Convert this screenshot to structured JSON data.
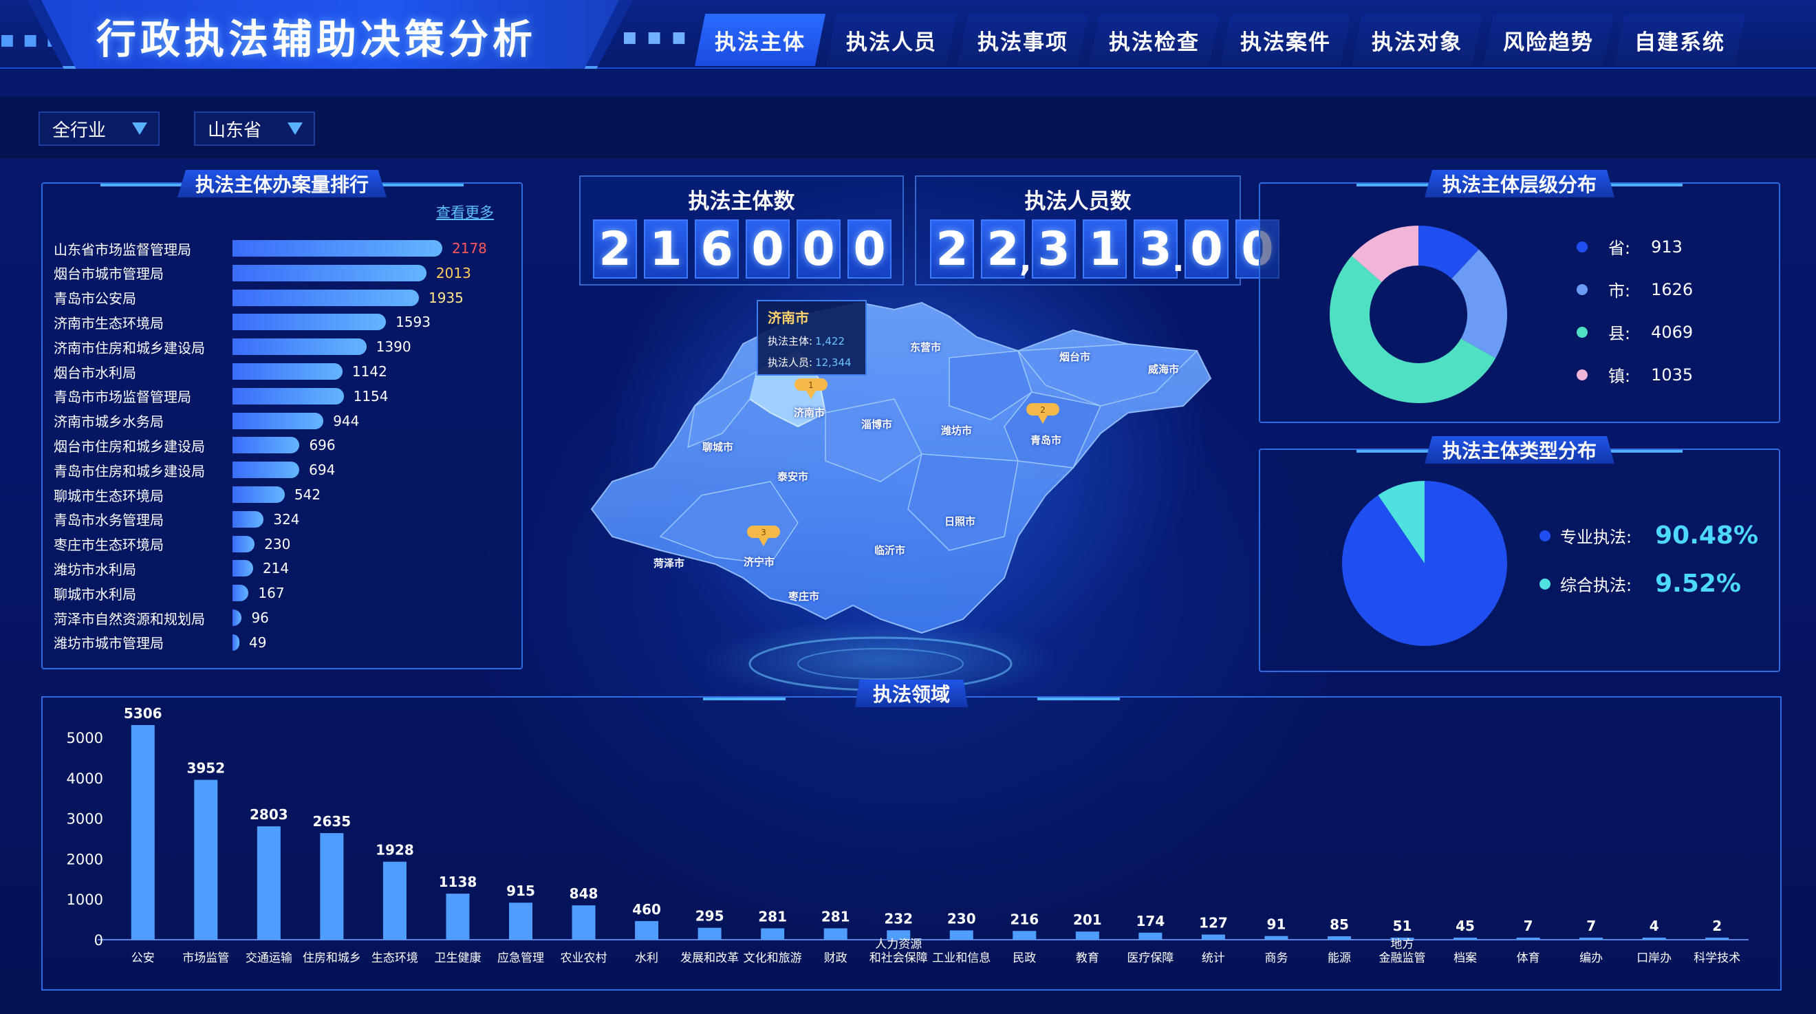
{
  "header": {
    "title": "行政执法辅助决策分析",
    "dots": "■ ■ ■",
    "tabs": [
      "执法主体",
      "执法人员",
      "执法事项",
      "执法检查",
      "执法案件",
      "执法对象",
      "风险趋势",
      "自建系统"
    ],
    "active_tab": 0
  },
  "filters": {
    "industry": "全行业",
    "province": "山东省"
  },
  "ranking": {
    "title": "执法主体办案量排行",
    "more_label": "查看更多",
    "items": [
      {
        "name": "山东省市场监督管理局",
        "value": 2178,
        "color": "#ff5a5a"
      },
      {
        "name": "烟台市城市管理局",
        "value": 2013,
        "color": "#ffcf5a"
      },
      {
        "name": "青岛市公安局",
        "value": 1935,
        "color": "#ffe88a"
      },
      {
        "name": "济南市生态环境局",
        "value": 1593,
        "color": "#ffffff"
      },
      {
        "name": "济南市住房和城乡建设局",
        "value": 1390,
        "color": "#ffffff"
      },
      {
        "name": "烟台市水利局",
        "value": 1142,
        "color": "#ffffff"
      },
      {
        "name": "青岛市市场监督管理局",
        "value": 1154,
        "color": "#ffffff"
      },
      {
        "name": "济南市城乡水务局",
        "value": 944,
        "color": "#ffffff"
      },
      {
        "name": "烟台市住房和城乡建设局",
        "value": 696,
        "color": "#ffffff"
      },
      {
        "name": "青岛市住房和城乡建设局",
        "value": 694,
        "color": "#ffffff"
      },
      {
        "name": "聊城市生态环境局",
        "value": 542,
        "color": "#ffffff"
      },
      {
        "name": "青岛市水务管理局",
        "value": 324,
        "color": "#ffffff"
      },
      {
        "name": "枣庄市生态环境局",
        "value": 230,
        "color": "#ffffff"
      },
      {
        "name": "潍坊市水利局",
        "value": 214,
        "color": "#ffffff"
      },
      {
        "name": "聊城市水利局",
        "value": 167,
        "color": "#ffffff"
      },
      {
        "name": "菏泽市自然资源和规划局",
        "value": 96,
        "color": "#ffffff"
      },
      {
        "name": "潍坊市城市管理局",
        "value": 49,
        "color": "#ffffff"
      }
    ]
  },
  "kpi": {
    "subjects_label": "执法主体数",
    "subjects_digits": [
      "2",
      "1",
      "6",
      "0",
      "0",
      "0"
    ],
    "staff_label": "执法人员数",
    "staff_digits": [
      "2",
      "2",
      ",",
      "3",
      "1",
      "3",
      ".",
      "0",
      "0"
    ]
  },
  "map": {
    "tooltip": {
      "city": "济南市",
      "subjects_label": "执法主体:",
      "subjects_value": "1,422",
      "staff_label": "执法人员:",
      "staff_value": "12,344"
    },
    "cities": [
      "济南市",
      "东营市",
      "烟台市",
      "威海市",
      "淄博市",
      "潍坊市",
      "青岛市",
      "聊城市",
      "泰安市",
      "日照市",
      "济宁市",
      "临沂市",
      "菏泽市",
      "枣庄市"
    ],
    "markers": [
      "1",
      "2",
      "3"
    ]
  },
  "level_dist": {
    "title": "执法主体层级分布",
    "items": [
      {
        "label": "省:",
        "value": 913,
        "color": "#1f4ff0"
      },
      {
        "label": "市:",
        "value": 1626,
        "color": "#6a9cf5"
      },
      {
        "label": "县:",
        "value": 4069,
        "color": "#4fe0c3"
      },
      {
        "label": "镇:",
        "value": 1035,
        "color": "#f2b5da"
      }
    ]
  },
  "type_dist": {
    "title": "执法主体类型分布",
    "items": [
      {
        "label": "专业执法:",
        "value": "90.48%",
        "fraction": 0.9048,
        "color": "#1f4ff0"
      },
      {
        "label": "综合执法:",
        "value": "9.52%",
        "fraction": 0.0952,
        "color": "#4fe0e0"
      }
    ]
  },
  "chart_data": {
    "type": "bar",
    "title": "执法领域",
    "xlabel": "",
    "ylabel": "",
    "ylim": [
      0,
      5000
    ],
    "yticks": [
      0,
      1000,
      2000,
      3000,
      4000,
      5000
    ],
    "categories": [
      "公安",
      "市场监管",
      "交通运输",
      "住房和城乡",
      "生态环境",
      "卫生健康",
      "应急管理",
      "农业农村",
      "水利",
      "发展和改革",
      "文化和旅游",
      "财政",
      "人力资源\n和社会保障",
      "工业和信息",
      "民政",
      "教育",
      "医疗保障",
      "统计",
      "商务",
      "能源",
      "地方\n金融监管",
      "档案",
      "体育",
      "编办",
      "口岸办",
      "科学技术"
    ],
    "values": [
      5306,
      3952,
      2803,
      2635,
      1928,
      1138,
      915,
      848,
      460,
      295,
      281,
      281,
      232,
      230,
      216,
      201,
      174,
      127,
      91,
      85,
      51,
      45,
      7,
      7,
      4,
      2
    ]
  }
}
